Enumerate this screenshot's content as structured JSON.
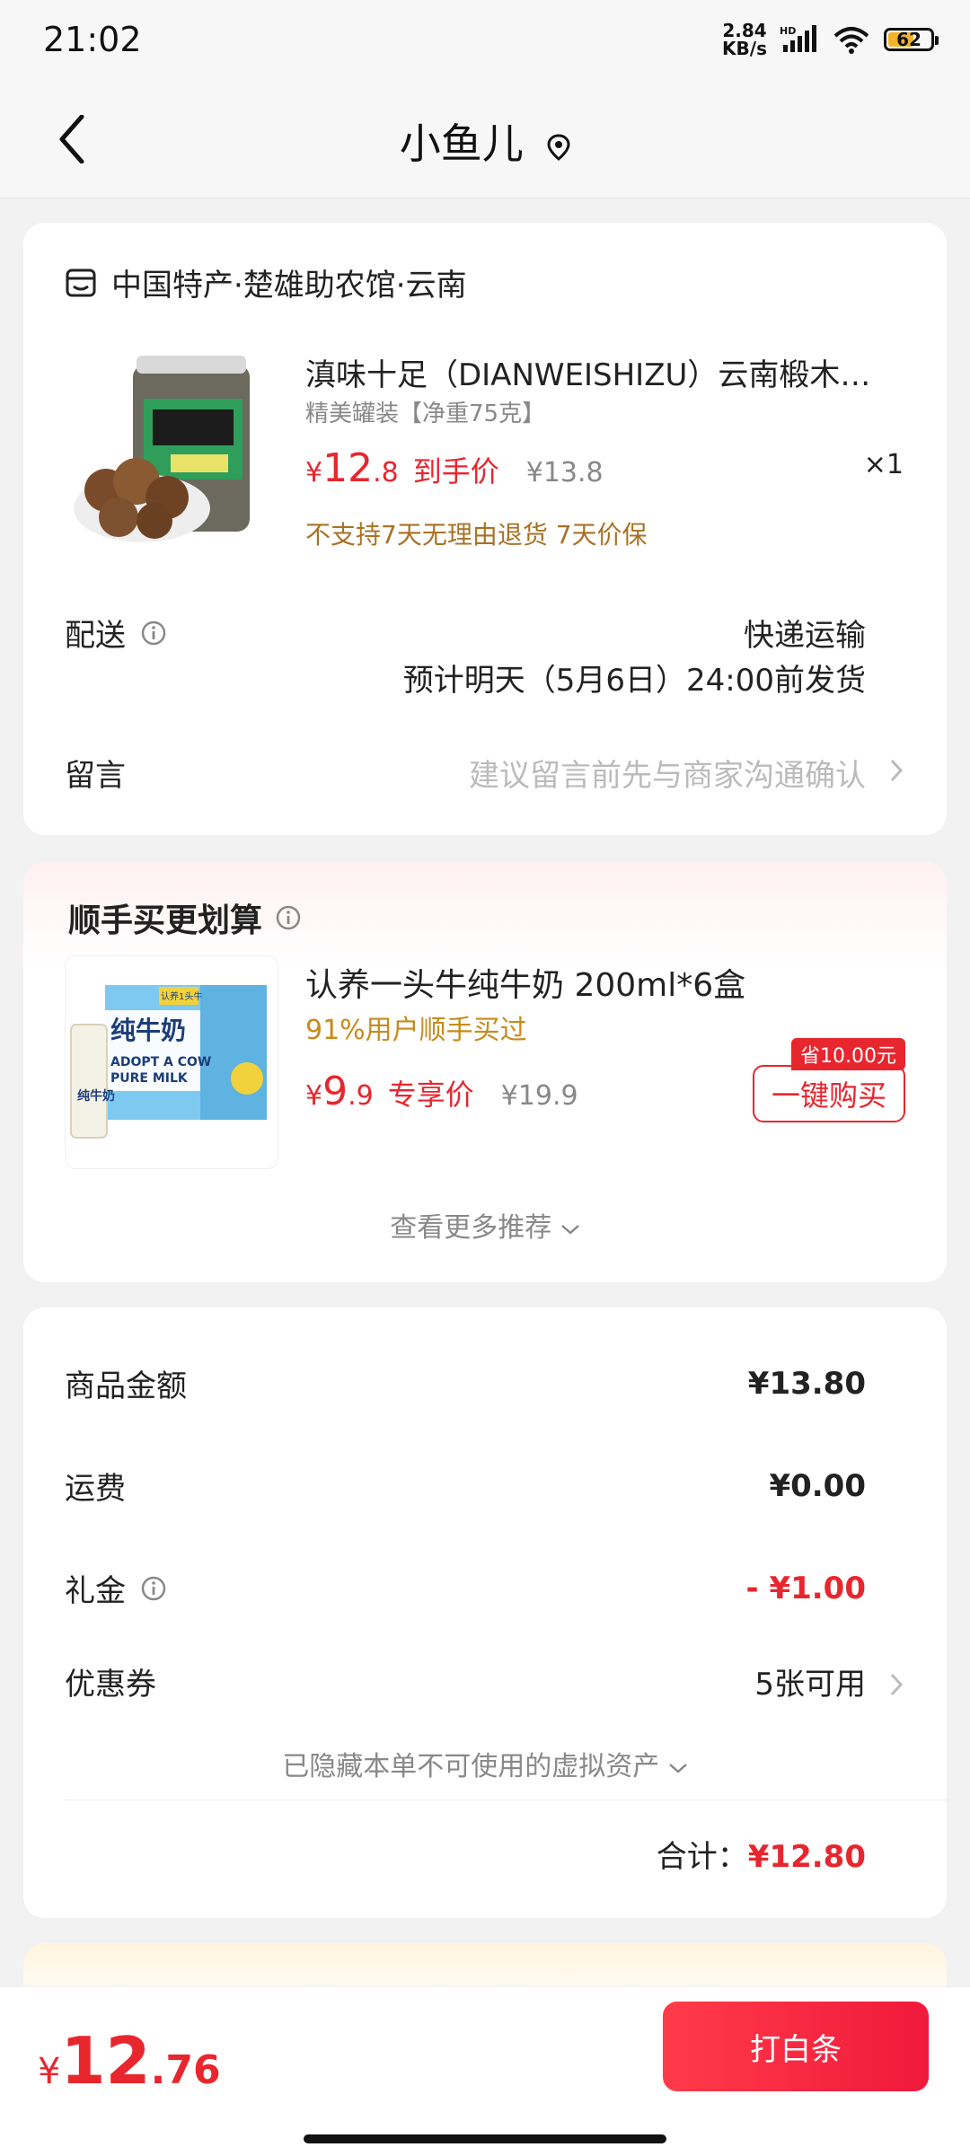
{
  "status_bar": {
    "time": "21:02",
    "net_speed_value": "2.84",
    "net_speed_unit": "KB/s",
    "network_hd": "HD",
    "battery": "62"
  },
  "header": {
    "title": "小鱼儿"
  },
  "order": {
    "shop_name": "中国特产·楚雄助农馆·云南",
    "product": {
      "title": "滇味十足（DIANWEISHIZU）云南椴木香菇",
      "spec": "精美罐装【净重75克】",
      "price_currency": "¥",
      "price_int": "12",
      "price_dec": ".8",
      "price_tag": "到手价",
      "original_price": "¥13.8",
      "quantity": "×1",
      "policy": "不支持7天无理由退货  7天价保"
    },
    "shipping": {
      "label": "配送",
      "method": "快递运输",
      "eta": "预计明天（5月6日）24:00前发货"
    },
    "message": {
      "label": "留言",
      "placeholder": "建议留言前先与商家沟通确认"
    }
  },
  "addon": {
    "title": "顺手买更划算",
    "product_name": "认养一头牛纯牛奶 200ml*6盒",
    "subtitle": "91%用户顺手买过",
    "price_currency": "¥",
    "price_int": "9",
    "price_dec": ".9",
    "price_tag": "专享价",
    "original_price": "¥19.9",
    "save_badge": "省10.00元",
    "buy_button": "一键购买",
    "more_link": "查看更多推荐",
    "image_text": {
      "brand": "认养1头牛",
      "main": "纯牛奶",
      "line1": "ADOPT A COW",
      "line2": "PURE MILK",
      "side": "纯牛奶"
    }
  },
  "summary": {
    "rows": [
      {
        "label": "商品金额",
        "value": "¥13.80"
      },
      {
        "label": "运费",
        "value": "¥0.00"
      },
      {
        "label": "礼金",
        "value": "- ¥1.00"
      },
      {
        "label": "优惠券",
        "value": "5张可用"
      }
    ],
    "hidden_assets": "已隐藏本单不可使用的虚拟资产",
    "total_label": "合计：",
    "total_value": "¥12.80"
  },
  "footer": {
    "price_currency": "¥",
    "price_int": "12",
    "price_dec": ".76",
    "pay_button": "打白条"
  },
  "colors": {
    "accent_red": "#e8262e",
    "gold": "#a87225",
    "muted": "#888888"
  }
}
